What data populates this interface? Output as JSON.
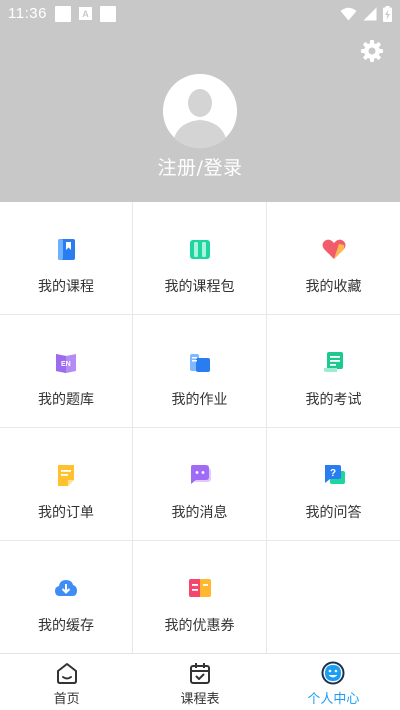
{
  "status_bar": {
    "time": "11:36",
    "a_label": "A"
  },
  "profile": {
    "login_label": "注册/登录"
  },
  "grid_items": [
    {
      "label": "我的课程",
      "icon": "course-book-icon"
    },
    {
      "label": "我的课程包",
      "icon": "course-package-icon"
    },
    {
      "label": "我的收藏",
      "icon": "favorite-heart-icon"
    },
    {
      "label": "我的题库",
      "icon": "question-bank-icon"
    },
    {
      "label": "我的作业",
      "icon": "homework-icon"
    },
    {
      "label": "我的考试",
      "icon": "exam-scroll-icon"
    },
    {
      "label": "我的订单",
      "icon": "order-icon"
    },
    {
      "label": "我的消息",
      "icon": "message-chat-icon"
    },
    {
      "label": "我的问答",
      "icon": "qa-icon"
    },
    {
      "label": "我的缓存",
      "icon": "cloud-download-icon"
    },
    {
      "label": "我的优惠券",
      "icon": "coupon-icon"
    }
  ],
  "icon_text": {
    "question_bank": "EN",
    "qa": "?"
  },
  "bottom_nav": [
    {
      "label": "首页",
      "icon": "home-icon",
      "active": false
    },
    {
      "label": "课程表",
      "icon": "calendar-icon",
      "active": false
    },
    {
      "label": "个人中心",
      "icon": "profile-smile-icon",
      "active": true
    }
  ],
  "colors": {
    "header_bg": "#c8c8c8",
    "active_nav": "#1a9df5"
  }
}
